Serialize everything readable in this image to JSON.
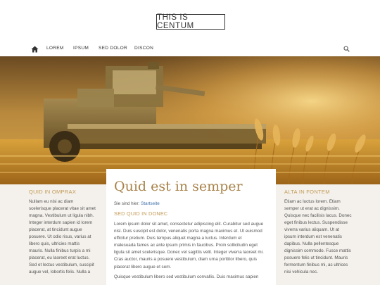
{
  "site": {
    "logo": "THIS IS CENTUM"
  },
  "nav": {
    "items": [
      {
        "label": "LOREM"
      },
      {
        "label": "IPSUM"
      },
      {
        "label": "SED DOLOR"
      },
      {
        "label": "DISCON"
      }
    ],
    "home_icon": "home-icon",
    "search_icon": "search-icon"
  },
  "colors": {
    "accent": "#c29a55",
    "title": "#a8824a",
    "link": "#3a6ea8",
    "panel": "#f4f1ec"
  },
  "left": {
    "title": "QUID IN OMPRAX",
    "lines": [
      "Nullam eu nisi ac diam",
      "scelerisque placerat vitae sit amet",
      "magna. Vestibulum ut ligula nibh.",
      "Integer interdum sapien id lorem",
      "placerat, at tincidunt augue",
      "posuere. Ut odio risus, varius at",
      "libero quis, ultricies mattis",
      "mauris. Nulla finibus turpis a mi",
      "placerat, eu laoreet erat luctus.",
      "Sed et lectus vestibulum, suscipit",
      "augue vel, lobortis felis. Nulla a"
    ]
  },
  "main": {
    "title": "Quid est in semper",
    "breadcrumb_prefix": "Sie sind hier:",
    "breadcrumb_link": "Startseite",
    "subtitle": "SED QUID IN DONEC",
    "paragraph1": [
      "Lorem ipsum dolor sit amet, consectetur adipiscing elit. Curabitur sed augue",
      "nisl. Duis suscipit est dolor, venenatis porta magna maximus et. Ut euismod",
      "efficitur pretium. Duis tempus aliquet magna a luctus. Interdum et",
      "malesuada fames ac ante ipsum primis in faucibus. Proin sollicitudin eget",
      "ligula sit amet scelerisque. Donec vel sagittis velit. Integer viverra laoreet mi.",
      "Cras auctor, mauris a posuere vestibulum, diam urna porttitor libero, quis",
      "placerat libero augue et sem."
    ],
    "paragraph2": [
      "Quisque vestibulum libero sed vestibulum convallis. Duis maximus sapien"
    ]
  },
  "right": {
    "title": "ALTA IN FONTEM",
    "lines": [
      "Etiam ac luctus lorem. Etiam",
      "semper ut erat ac dignissim.",
      "Quisque nec facilisis lacus. Donec",
      "eget finibus lectus. Suspendisse",
      "viverra varius aliquam. Ut at",
      "ipsum interdum est venenatis",
      "dapibus. Nulla pellentesque",
      "dignissim commodo. Fusce mattis",
      "posuere felis ut tincidunt. Mauris",
      "fermentum finibus mi, ac ultrices",
      "nisi vehicula nec."
    ]
  }
}
